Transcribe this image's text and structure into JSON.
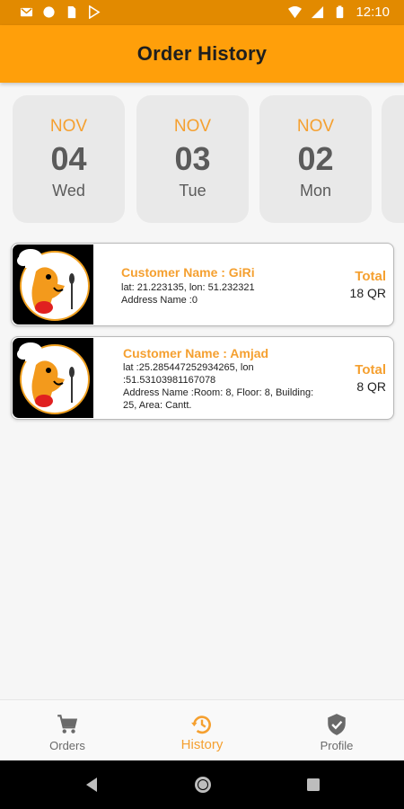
{
  "status_bar": {
    "time": "12:10",
    "left_icons": [
      "gmail-icon",
      "circle-notification-icon",
      "sim-card-icon",
      "play-store-icon"
    ],
    "right_icons": [
      "wifi-icon",
      "signal-icon",
      "battery-icon"
    ]
  },
  "header": {
    "title": "Order History"
  },
  "dates": [
    {
      "month": "NOV",
      "day": "04",
      "weekday": "Wed"
    },
    {
      "month": "NOV",
      "day": "03",
      "weekday": "Tue"
    },
    {
      "month": "NOV",
      "day": "02",
      "weekday": "Mon"
    }
  ],
  "orders": [
    {
      "customer": "Customer Name : GiRi",
      "lines": [
        "lat: 21.223135,  lon: 51.232321",
        "Address Name :0"
      ],
      "total_label": "Total",
      "total_value": "18 QR"
    },
    {
      "customer": "Customer Name : Amjad",
      "lines": [
        "lat :25.285447252934265, lon",
        ":51.53103981167078",
        "Address Name :Room: 8, Floor: 8, Building:",
        "25, Area: Cantt."
      ],
      "total_label": "Total",
      "total_value": "8 QR"
    }
  ],
  "bottom_nav": [
    {
      "label": "Orders",
      "icon": "cart-icon",
      "active": false
    },
    {
      "label": "History",
      "icon": "history-icon",
      "active": true
    },
    {
      "label": "Profile",
      "icon": "shield-check-icon",
      "active": false
    }
  ],
  "colors": {
    "primary": "#ff9f0a",
    "status_bar": "#e28a00",
    "accent_text": "#f5a030",
    "card_bg": "#e9e9e9"
  }
}
